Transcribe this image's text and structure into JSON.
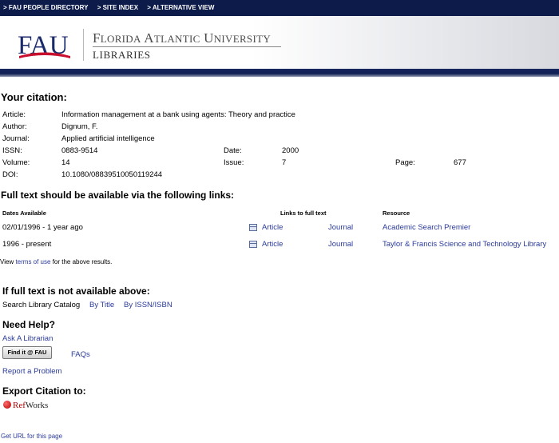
{
  "nav": {
    "items": [
      "> FAU PEOPLE DIRECTORY",
      "> SITE INDEX",
      "> ALTERNATIVE VIEW"
    ]
  },
  "header": {
    "logo_text": "FAU",
    "university_name": "Florida Atlantic University",
    "library_name": "Libraries"
  },
  "citation": {
    "heading": "Your citation:",
    "article_label": "Article:",
    "article": "Information management at a bank using agents: Theory and practice",
    "author_label": "Author:",
    "author": "Dignum, F.",
    "journal_label": "Journal:",
    "journal": "Applied artificial intelligence",
    "issn_label": "ISSN:",
    "issn": "0883-9514",
    "date_label": "Date:",
    "date": "2000",
    "volume_label": "Volume:",
    "volume": "14",
    "issue_label": "Issue:",
    "issue": "7",
    "page_label": "Page:",
    "page": "677",
    "doi_label": "DOI:",
    "doi": "10.1080/08839510050119244"
  },
  "fulltext": {
    "heading": "Full text should be available via the following links:",
    "col_dates": "Dates Available",
    "col_links": "Links to full text",
    "col_resource": "Resource",
    "rows": [
      {
        "dates": "02/01/1996 - 1 year ago",
        "article": "Article",
        "journal": "Journal",
        "resource": "Academic Search Premier"
      },
      {
        "dates": "1996 - present",
        "article": "Article",
        "journal": "Journal",
        "resource": "Taylor & Francis Science and Technology Library"
      }
    ],
    "terms_prefix": "View",
    "terms_link": "terms of use",
    "terms_suffix": "for the above results."
  },
  "not_available": {
    "heading": "If full text is not available above:",
    "catalog_label": "Search Library Catalog",
    "by_title": "By Title",
    "by_issn": "By ISSN/ISBN"
  },
  "help": {
    "heading": "Need Help?",
    "ask": "Ask A Librarian",
    "findit": "Find it @ FAU",
    "faqs": "FAQs",
    "report": "Report a Problem"
  },
  "export": {
    "heading": "Export Citation to:",
    "refworks_r": "Ref",
    "refworks_rest": "Works"
  },
  "footer": {
    "get_url": "Get URL for this page"
  },
  "colors": {
    "nav_bg": "#0d1b4b",
    "link": "#2a3a9a",
    "logo_red": "#c8102e",
    "logo_blue": "#1b2a6b"
  }
}
